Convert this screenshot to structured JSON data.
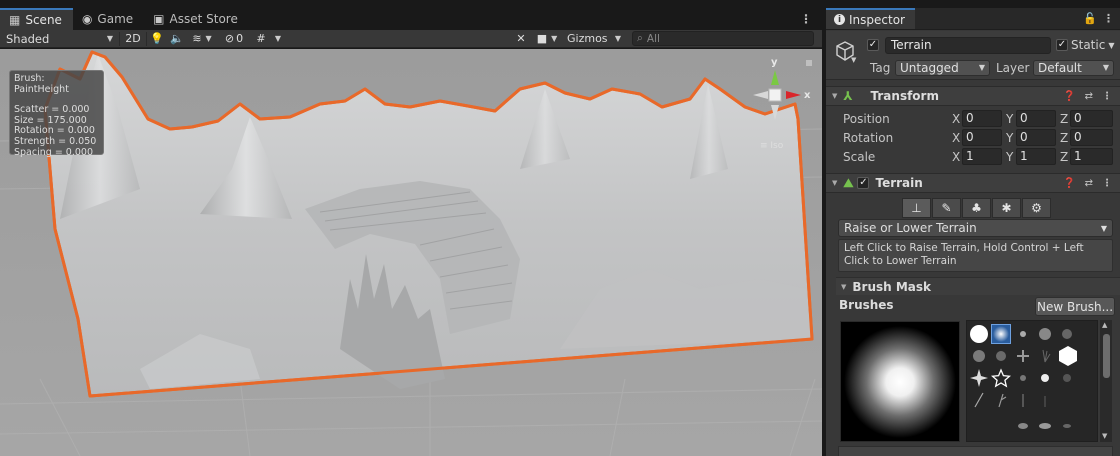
{
  "scene": {
    "tabs": [
      {
        "label": "Scene",
        "icon": "grid-icon"
      },
      {
        "label": "Game",
        "icon": "gamepad-icon"
      },
      {
        "label": "Asset Store",
        "icon": "bag-icon"
      }
    ],
    "toolbar": {
      "shading_mode": "Shaded",
      "mode_2d": "2D",
      "hidden_count": "0",
      "gizmos": "Gizmos",
      "search_placeholder": "All"
    },
    "brush_overlay": {
      "title": "Brush: PaintHeight",
      "scatter": "Scatter = 0.000",
      "size": "Size = 175.000",
      "rotation": "Rotation = 0.000",
      "strength": "Strength = 0.050",
      "spacing": "Spacing = 0.000"
    },
    "gizmo": {
      "y": "y",
      "x": "x",
      "projection": "Iso"
    },
    "colors": {
      "selection_outline": "#e8692a",
      "terrain": "#c9cacb",
      "grid_bg": "#a3a3a3"
    }
  },
  "inspector": {
    "tab_label": "Inspector",
    "object": {
      "name": "Terrain",
      "static_label": "Static",
      "tag_label": "Tag",
      "tag_value": "Untagged",
      "layer_label": "Layer",
      "layer_value": "Default"
    },
    "transform": {
      "title": "Transform",
      "rows": [
        {
          "label": "Position",
          "x": "0",
          "y": "0",
          "z": "0"
        },
        {
          "label": "Rotation",
          "x": "0",
          "y": "0",
          "z": "0"
        },
        {
          "label": "Scale",
          "x": "1",
          "y": "1",
          "z": "1"
        }
      ],
      "axis": {
        "x": "X",
        "y": "Y",
        "z": "Z"
      }
    },
    "terrain": {
      "title": "Terrain",
      "tool_dropdown": "Raise or Lower Terrain",
      "help_text": "Left Click to Raise Terrain, Hold Control + Left Click to Lower Terrain",
      "brush_mask_title": "Brush Mask",
      "brushes_label": "Brushes",
      "new_brush_label": "New Brush..."
    }
  }
}
